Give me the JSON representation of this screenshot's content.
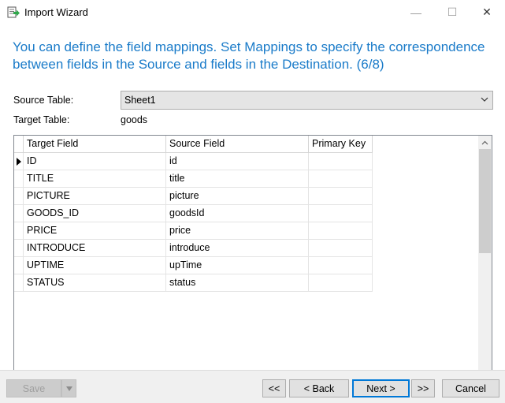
{
  "window": {
    "title": "Import Wizard",
    "minimize_glyph": "—",
    "maximize_glyph": "☐",
    "close_glyph": "✕"
  },
  "heading": "You can define the field mappings. Set Mappings to specify the correspondence between fields in the Source and fields in the Destination. (6/8)",
  "form": {
    "source_table_label": "Source Table:",
    "source_table_value": "Sheet1",
    "target_table_label": "Target Table:",
    "target_table_value": "goods"
  },
  "grid": {
    "columns": [
      "Target Field",
      "Source Field",
      "Primary Key"
    ],
    "current_row": 0,
    "rows": [
      {
        "target": "ID",
        "source": "id",
        "pk": ""
      },
      {
        "target": "TITLE",
        "source": "title",
        "pk": ""
      },
      {
        "target": "PICTURE",
        "source": "picture",
        "pk": ""
      },
      {
        "target": "GOODS_ID",
        "source": "goodsId",
        "pk": ""
      },
      {
        "target": "PRICE",
        "source": "price",
        "pk": ""
      },
      {
        "target": "INTRODUCE",
        "source": "introduce",
        "pk": ""
      },
      {
        "target": "UPTIME",
        "source": "upTime",
        "pk": ""
      },
      {
        "target": "STATUS",
        "source": "status",
        "pk": ""
      }
    ]
  },
  "buttons": {
    "save": "Save",
    "first": "<<",
    "back": "< Back",
    "next": "Next >",
    "last": ">>",
    "cancel": "Cancel"
  },
  "colors": {
    "heading": "#1a7bc9",
    "default_button_border": "#0078d7"
  }
}
